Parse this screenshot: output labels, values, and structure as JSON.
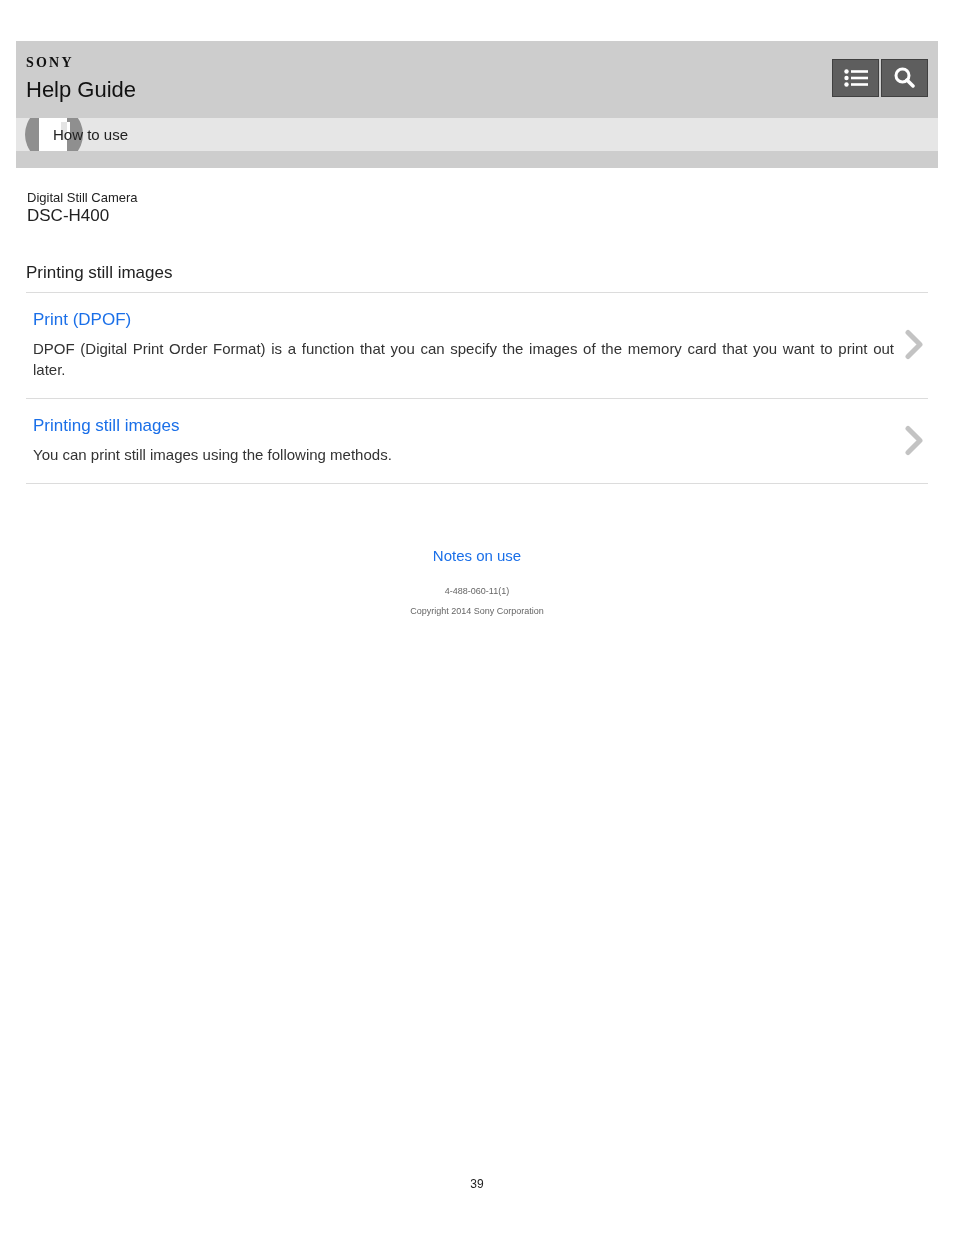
{
  "header": {
    "logo": "SONY",
    "title": "Help Guide"
  },
  "breadcrumb": {
    "label": "How to use"
  },
  "product": {
    "category": "Digital Still Camera",
    "model": "DSC-H400"
  },
  "section": {
    "title": "Printing still images",
    "items": [
      {
        "title": "Print (DPOF)",
        "description": "DPOF (Digital Print Order Format) is a function that you can specify the images of the memory card that you want to print out later."
      },
      {
        "title": "Printing still images",
        "description": "You can print still images using the following methods."
      }
    ]
  },
  "footer": {
    "link": "Notes on use",
    "doc_number": "4-488-060-11(1)",
    "copyright": "Copyright 2014 Sony Corporation"
  },
  "page_number": "39"
}
